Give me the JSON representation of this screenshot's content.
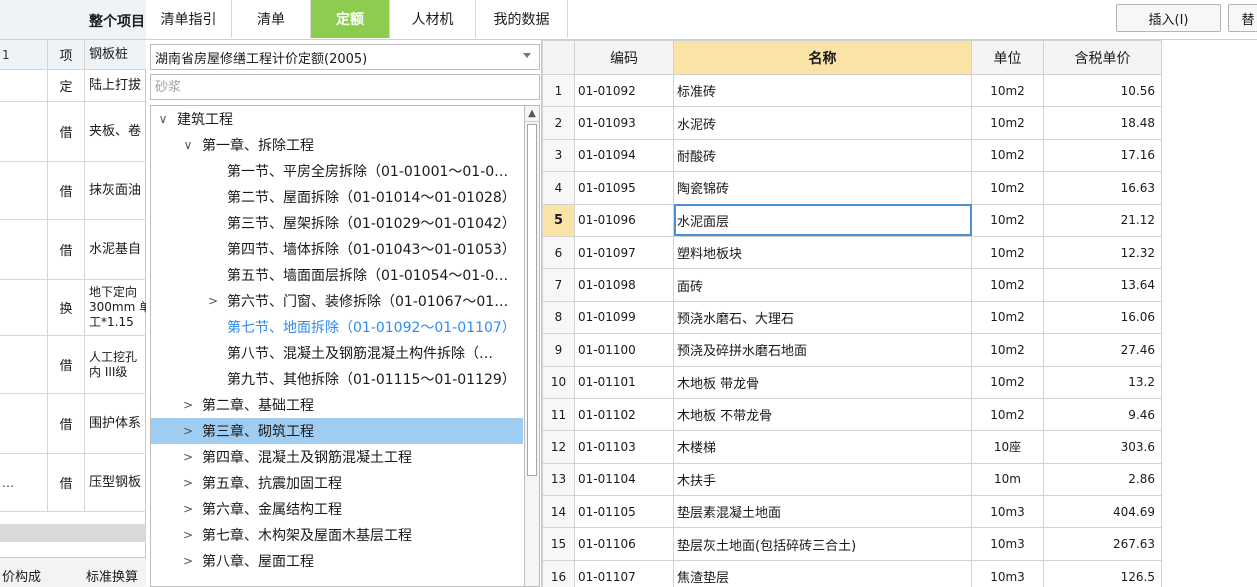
{
  "tabs": [
    {
      "label": "清单指引",
      "active": false
    },
    {
      "label": "清单",
      "active": false
    },
    {
      "label": "定额",
      "active": true
    },
    {
      "label": "人材机",
      "active": false
    },
    {
      "label": "我的数据",
      "active": false
    }
  ],
  "toolbar": {
    "insert_label": "插入(I)",
    "replace_label": "替"
  },
  "library": {
    "selected": "湖南省房屋修缮工程计价定额(2005)"
  },
  "search": {
    "placeholder": "砂浆",
    "value": ""
  },
  "tree": [
    {
      "label": "建筑工程",
      "arrow": "∨",
      "level": 0,
      "selected": false,
      "current": false
    },
    {
      "label": "第一章、拆除工程",
      "arrow": "∨",
      "level": 1,
      "selected": false,
      "current": false
    },
    {
      "label": "第一节、平房全房拆除（01-01001～01-0…",
      "arrow": "",
      "level": 2,
      "selected": false,
      "current": false
    },
    {
      "label": "第二节、屋面拆除（01-01014～01-01028）",
      "arrow": "",
      "level": 2,
      "selected": false,
      "current": false
    },
    {
      "label": "第三节、屋架拆除（01-01029～01-01042）",
      "arrow": "",
      "level": 2,
      "selected": false,
      "current": false
    },
    {
      "label": "第四节、墙体拆除（01-01043～01-01053）",
      "arrow": "",
      "level": 2,
      "selected": false,
      "current": false
    },
    {
      "label": "第五节、墙面面层拆除（01-01054～01-0…",
      "arrow": "",
      "level": 2,
      "selected": false,
      "current": false
    },
    {
      "label": "第六节、门窗、装修拆除（01-01067～01…",
      "arrow": ">",
      "level": 2,
      "selected": false,
      "current": false
    },
    {
      "label": "第七节、地面拆除（01-01092～01-01107）",
      "arrow": "",
      "level": 2,
      "selected": false,
      "current": true
    },
    {
      "label": "第八节、混凝土及钢筋混凝土构件拆除（…",
      "arrow": "",
      "level": 2,
      "selected": false,
      "current": false
    },
    {
      "label": "第九节、其他拆除（01-01115～01-01129）",
      "arrow": "",
      "level": 2,
      "selected": false,
      "current": false
    },
    {
      "label": "第二章、基础工程",
      "arrow": ">",
      "level": 1,
      "selected": false,
      "current": false
    },
    {
      "label": "第三章、砌筑工程",
      "arrow": ">",
      "level": 1,
      "selected": true,
      "current": false
    },
    {
      "label": "第四章、混凝土及钢筋混凝土工程",
      "arrow": ">",
      "level": 1,
      "selected": false,
      "current": false
    },
    {
      "label": "第五章、抗震加固工程",
      "arrow": ">",
      "level": 1,
      "selected": false,
      "current": false
    },
    {
      "label": "第六章、金属结构工程",
      "arrow": ">",
      "level": 1,
      "selected": false,
      "current": false
    },
    {
      "label": "第七章、木构架及屋面木基层工程",
      "arrow": ">",
      "level": 1,
      "selected": false,
      "current": false
    },
    {
      "label": "第八章、屋面工程",
      "arrow": ">",
      "level": 1,
      "selected": false,
      "current": false
    }
  ],
  "table": {
    "headers": {
      "code": "编码",
      "name": "名称",
      "unit": "单位",
      "price": "含税单价"
    },
    "rows": [
      {
        "n": "1",
        "code": "01-01092",
        "name": "标准砖",
        "unit": "10m2",
        "price": "10.56"
      },
      {
        "n": "2",
        "code": "01-01093",
        "name": "水泥砖",
        "unit": "10m2",
        "price": "18.48"
      },
      {
        "n": "3",
        "code": "01-01094",
        "name": "耐酸砖",
        "unit": "10m2",
        "price": "17.16"
      },
      {
        "n": "4",
        "code": "01-01095",
        "name": "陶瓷锦砖",
        "unit": "10m2",
        "price": "16.63"
      },
      {
        "n": "5",
        "code": "01-01096",
        "name": "水泥面层",
        "unit": "10m2",
        "price": "21.12"
      },
      {
        "n": "6",
        "code": "01-01097",
        "name": "塑料地板块",
        "unit": "10m2",
        "price": "12.32"
      },
      {
        "n": "7",
        "code": "01-01098",
        "name": "面砖",
        "unit": "10m2",
        "price": "13.64"
      },
      {
        "n": "8",
        "code": "01-01099",
        "name": "预浇水磨石、大理石",
        "unit": "10m2",
        "price": "16.06"
      },
      {
        "n": "9",
        "code": "01-01100",
        "name": "预浇及碎拼水磨石地面",
        "unit": "10m2",
        "price": "27.46"
      },
      {
        "n": "10",
        "code": "01-01101",
        "name": "木地板 带龙骨",
        "unit": "10m2",
        "price": "13.2"
      },
      {
        "n": "11",
        "code": "01-01102",
        "name": "木地板 不带龙骨",
        "unit": "10m2",
        "price": "9.46"
      },
      {
        "n": "12",
        "code": "01-01103",
        "name": "木楼梯",
        "unit": "10座",
        "price": "303.6"
      },
      {
        "n": "13",
        "code": "01-01104",
        "name": "木扶手",
        "unit": "10m",
        "price": "2.86"
      },
      {
        "n": "14",
        "code": "01-01105",
        "name": "垫层素混凝土地面",
        "unit": "10m3",
        "price": "404.69"
      },
      {
        "n": "15",
        "code": "01-01106",
        "name": "垫层灰土地面(包括碎砖三合土)",
        "unit": "10m3",
        "price": "267.63"
      },
      {
        "n": "16",
        "code": "01-01107",
        "name": "焦渣垫层",
        "unit": "10m3",
        "price": "126.5"
      }
    ],
    "current_row": 4
  },
  "bg_grid": {
    "header": "整个项目",
    "rows": [
      {
        "c0": "1",
        "c1": "项",
        "c2": "钢板桩"
      },
      {
        "c0": "",
        "c1": "定",
        "c2": "陆上打拔"
      },
      {
        "c0": "",
        "c1": "借",
        "c2": "夹板、卷"
      },
      {
        "c0": "",
        "c1": "借",
        "c2": "抹灰面油"
      },
      {
        "c0": "",
        "c1": "借",
        "c2": "水泥基自"
      },
      {
        "c0": "",
        "c1": "换",
        "c2": "地下定向\n300mm 单\n工*1.15"
      },
      {
        "c0": "",
        "c1": "借",
        "c2": "人工挖孔\n内 III级"
      },
      {
        "c0": "",
        "c1": "借",
        "c2": "围护体系"
      },
      {
        "c0": "…",
        "c1": "借",
        "c2": "压型钢板"
      }
    ],
    "tabs": [
      "价构成",
      "标准换算"
    ]
  }
}
